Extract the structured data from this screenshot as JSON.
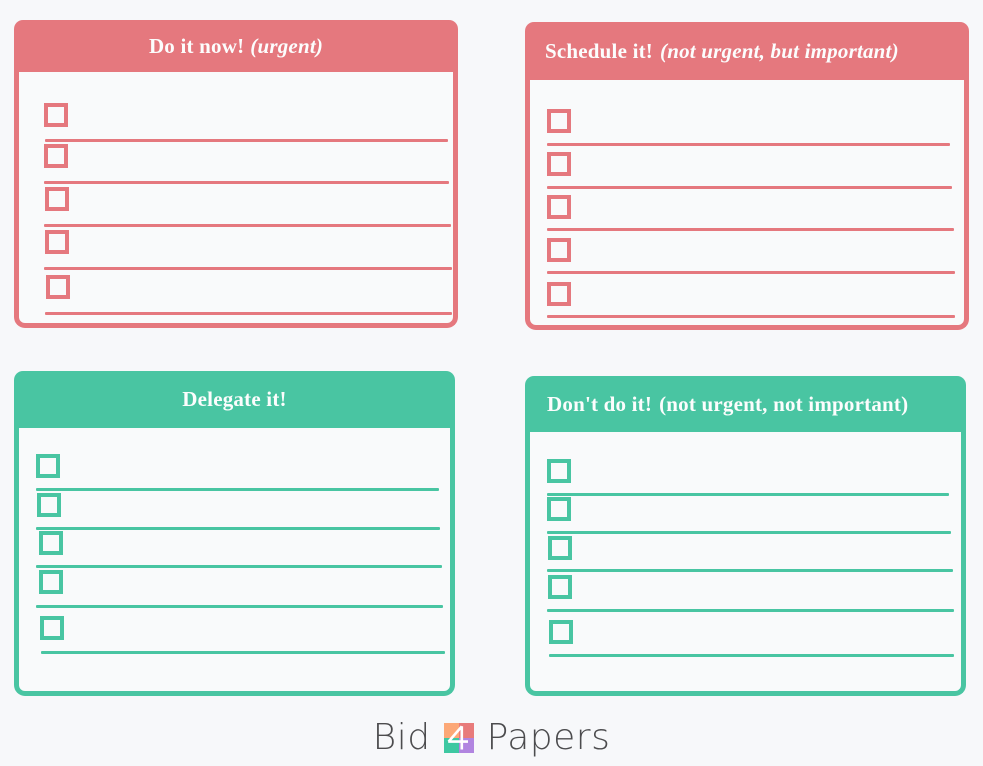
{
  "page": {
    "background_color": "#f7f8fa",
    "title": "Eisenhower Matrix Checklist"
  },
  "colors": {
    "urgent_accent": "#e5787e",
    "urgent_rule": "#e5787e",
    "calm_accent": "#49c5a2",
    "calm_rule": "#49c5a2",
    "header_text": "#fcfdfd",
    "card_fill": "#f9fafb",
    "brand_text": "#4c4c4e",
    "logo_top_left": "#fca877",
    "logo_top_right": "#e87b7b",
    "logo_bottom_left": "#3ec8a2",
    "logo_bottom_right": "#b185e0"
  },
  "quadrants": [
    {
      "id": "do-it-now",
      "title_main": "Do it now!",
      "title_sub": "(urgent)",
      "title_sub_style": "italic",
      "accent": "urgent",
      "checkbox_count": 5,
      "checkbox_labels": [
        "",
        "",
        "",
        "",
        ""
      ]
    },
    {
      "id": "schedule-it",
      "title_main": "Schedule it!",
      "title_sub": "(not urgent, but important)",
      "title_sub_style": "italic",
      "accent": "urgent",
      "checkbox_count": 5,
      "checkbox_labels": [
        "",
        "",
        "",
        "",
        ""
      ]
    },
    {
      "id": "delegate-it",
      "title_main": "Delegate it!",
      "title_sub": "",
      "title_sub_style": "none",
      "accent": "calm",
      "checkbox_count": 5,
      "checkbox_labels": [
        "",
        "",
        "",
        "",
        ""
      ]
    },
    {
      "id": "dont-do-it",
      "title_main": "Don't do it!",
      "title_sub": "(not urgent, not important)",
      "title_sub_style": "plain",
      "accent": "calm",
      "checkbox_count": 5,
      "checkbox_labels": [
        "",
        "",
        "",
        "",
        ""
      ]
    }
  ],
  "brand": {
    "word_left": "Bid",
    "word_right": "Papers",
    "mark_icon": "four-square-logo-icon",
    "mark_digit": "4"
  }
}
